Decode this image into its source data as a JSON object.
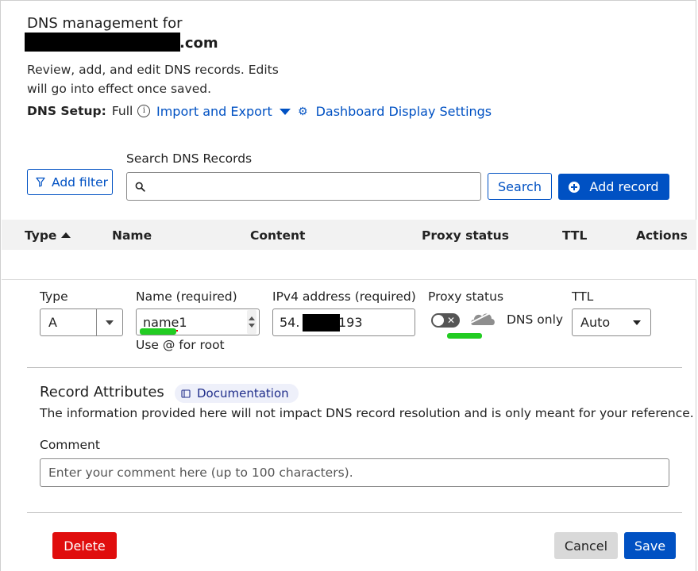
{
  "header": {
    "title_line1": "DNS management for",
    "domain_suffix": ".com",
    "description": "Review, add, and edit DNS records. Edits will go into effect once saved.",
    "dns_setup_label": "DNS Setup:",
    "dns_setup_value": "Full",
    "info_icon_glyph": "i",
    "import_export": "Import and Export",
    "dashboard_settings": "Dashboard Display Settings"
  },
  "toolbar": {
    "search_label": "Search DNS Records",
    "search_placeholder": "",
    "add_filter": "Add filter",
    "search_button": "Search",
    "add_record": "Add record"
  },
  "table": {
    "columns": [
      "Type",
      "Name",
      "Content",
      "Proxy status",
      "TTL",
      "Actions"
    ],
    "sort_column": "Type",
    "sort_direction": "ascending"
  },
  "record_form": {
    "type_label": "Type",
    "type_value": "A",
    "name_label": "Name (required)",
    "name_value": "name1",
    "name_hint": "Use @ for root",
    "ipv4_label": "IPv4 address (required)",
    "ipv4_prefix": "54.",
    "ipv4_suffix": "193",
    "proxy_label": "Proxy status",
    "proxy_toggle_on": false,
    "proxy_state": "DNS only",
    "ttl_label": "TTL",
    "ttl_value": "Auto"
  },
  "attributes": {
    "title": "Record Attributes",
    "documentation": "Documentation",
    "description": "The information provided here will not impact DNS record resolution and is only meant for your reference.",
    "comment_label": "Comment",
    "comment_placeholder": "Enter your comment here (up to 100 characters)."
  },
  "actions": {
    "delete": "Delete",
    "cancel": "Cancel",
    "save": "Save"
  },
  "colors": {
    "primary_blue": "#0051c3",
    "danger_red": "#e00d0d",
    "redaction_black": "#000000",
    "annotation_green": "#22cc22"
  },
  "icons": {
    "info": "info-icon",
    "caret": "chevron-down-icon",
    "gear": "gear-icon",
    "filter": "filter-icon",
    "search": "search-icon",
    "plus": "plus-circle-icon",
    "cloud": "cloud-icon",
    "book": "book-icon"
  }
}
